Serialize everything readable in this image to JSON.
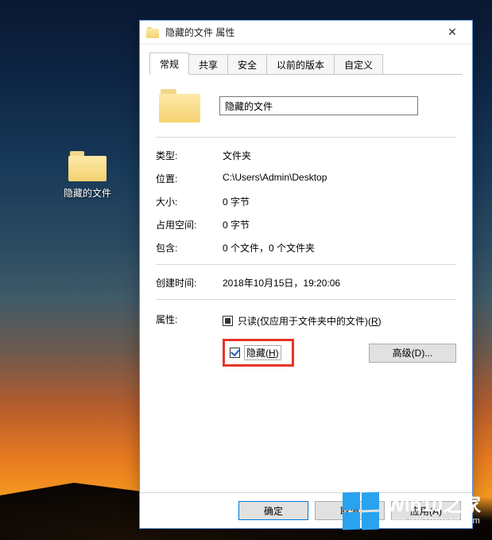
{
  "desktop": {
    "icon_label": "隐藏的文件"
  },
  "dialog": {
    "title": "隐藏的文件 属性",
    "tabs": [
      "常规",
      "共享",
      "安全",
      "以前的版本",
      "自定义"
    ],
    "active_tab": 0,
    "name_value": "隐藏的文件",
    "props": {
      "type_label": "类型:",
      "type_value": "文件夹",
      "location_label": "位置:",
      "location_value": "C:\\Users\\Admin\\Desktop",
      "size_label": "大小:",
      "size_value": "0 字节",
      "disk_label": "占用空间:",
      "disk_value": "0 字节",
      "contains_label": "包含:",
      "contains_value": "0 个文件，0 个文件夹",
      "created_label": "创建时间:",
      "created_value": "2018年10月15日，19:20:06"
    },
    "attributes": {
      "label": "属性:",
      "readonly_text": "只读(仅应用于文件夹中的文件)(",
      "readonly_key": "R",
      "readonly_suffix": ")",
      "hidden_text": "隐藏(",
      "hidden_key": "H",
      "hidden_suffix": ")",
      "advanced_btn": "高级(D)...",
      "readonly_state": "indeterminate",
      "hidden_state": "checked"
    },
    "buttons": {
      "ok": "确定",
      "cancel": "取消",
      "apply": "应用(A)"
    }
  },
  "watermark": {
    "title": "Win10之家",
    "sub": "www.win10xitong.com"
  }
}
